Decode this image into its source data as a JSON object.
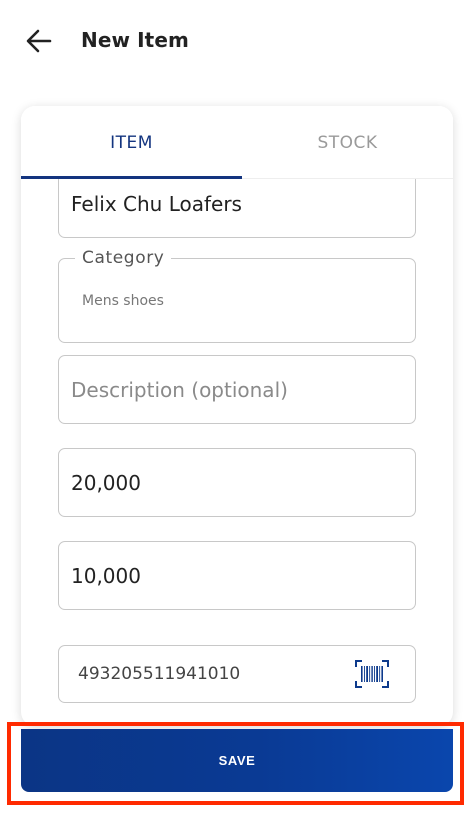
{
  "header": {
    "title": "New Item",
    "back_icon": "arrow-left-icon"
  },
  "tabs": [
    {
      "label": "ITEM",
      "active": true
    },
    {
      "label": "STOCK",
      "active": false
    }
  ],
  "form": {
    "name": {
      "value": "Felix Chu Loafers"
    },
    "category": {
      "label": "Category",
      "value": "Mens shoes"
    },
    "description": {
      "placeholder": "Description (optional)"
    },
    "price": {
      "value": "20,000"
    },
    "cost": {
      "value": "10,000"
    },
    "barcode": {
      "value": "493205511941010",
      "icon": "barcode-icon"
    }
  },
  "actions": {
    "save_label": "SAVE"
  },
  "colors": {
    "primary": "#13347f",
    "save_button": "#0a3a94",
    "highlight": "#ff2a00"
  }
}
